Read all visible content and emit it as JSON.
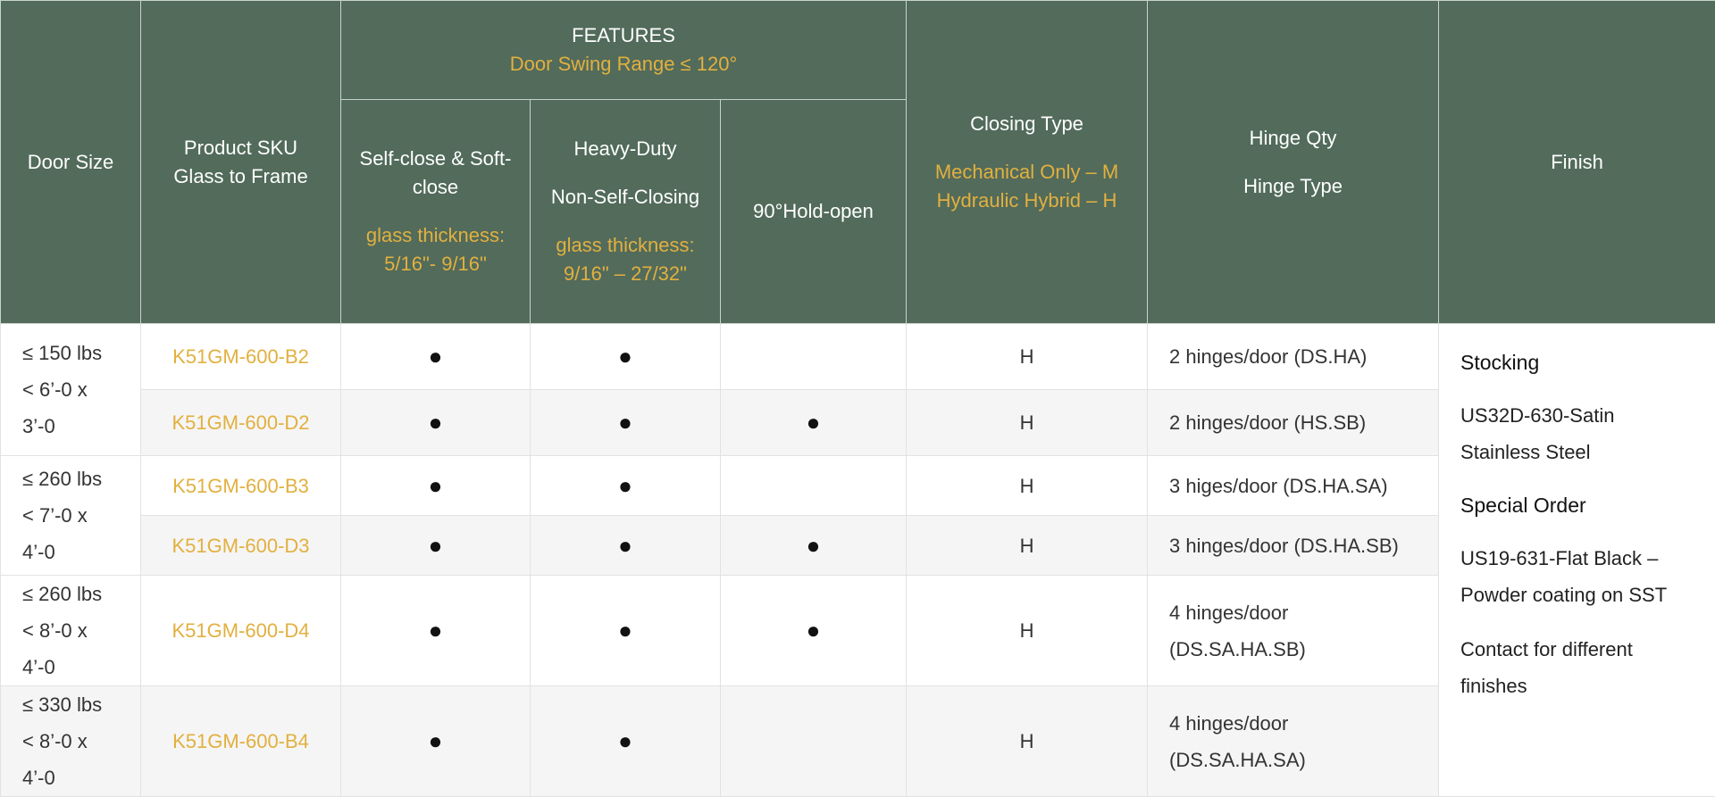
{
  "header": {
    "door_size": "Door Size",
    "sku_line1": "Product SKU",
    "sku_line2": "Glass to Frame",
    "features": "FEATURES",
    "features_sub": "Door Swing Range ≤ 120°",
    "selfclose_line1": "Self-close & Soft-close",
    "selfclose_glass_line1": "glass thickness:",
    "selfclose_glass_line2": "5/16\"- 9/16\"",
    "heavy_line1": "Heavy-Duty",
    "heavy_line2": "Non-Self-Closing",
    "heavy_glass_line1": "glass thickness:",
    "heavy_glass_line2": "9/16\" – 27/32\"",
    "hold_open": "90°Hold-open",
    "closing_type": "Closing Type",
    "closing_m": "Mechanical Only – M",
    "closing_h": "Hydraulic Hybrid – H",
    "hinge_qty": "Hinge Qty",
    "hinge_type": "Hinge Type",
    "finish": "Finish"
  },
  "groups": [
    {
      "weight": "≤ 150 lbs",
      "size": "< 6’-0 x 3’-0"
    },
    {
      "weight": "≤ 260 lbs",
      "size": "< 7’-0 x 4’-0"
    },
    {
      "weight": "≤ 260 lbs",
      "size": "< 8’-0 x 4’-0"
    },
    {
      "weight": "≤ 330 lbs",
      "size": "< 8’-0 x 4’-0"
    }
  ],
  "rows": [
    {
      "sku": "K51GM-600-B2",
      "selfclose": "●",
      "heavy": "●",
      "hold": "",
      "closing": "H",
      "hinge": "2 hinges/door (DS.HA)"
    },
    {
      "sku": "K51GM-600-D2",
      "selfclose": "●",
      "heavy": "●",
      "hold": "●",
      "closing": "H",
      "hinge": "2 hinges/door (HS.SB)"
    },
    {
      "sku": "K51GM-600-B3",
      "selfclose": "●",
      "heavy": "●",
      "hold": "",
      "closing": "H",
      "hinge": "3 higes/door (DS.HA.SA)"
    },
    {
      "sku": "K51GM-600-D3",
      "selfclose": "●",
      "heavy": "●",
      "hold": "●",
      "closing": "H",
      "hinge": "3 hinges/door (DS.HA.SB)"
    },
    {
      "sku": "K51GM-600-D4",
      "selfclose": "●",
      "heavy": "●",
      "hold": "●",
      "closing": "H",
      "hinge_line1": "4 hinges/door",
      "hinge_line2": "(DS.SA.HA.SB)"
    },
    {
      "sku": "K51GM-600-B4",
      "selfclose": "●",
      "heavy": "●",
      "hold": "",
      "closing": "H",
      "hinge_line1": "4 hinges/door",
      "hinge_line2": "(DS.SA.HA.SA)"
    }
  ],
  "finish": {
    "stocking_head": "Stocking",
    "stocking_text": "US32D-630-Satin Stainless Steel",
    "special_head": "Special Order",
    "special_text": "US19-631-Flat Black – Powder coating on SST",
    "contact_text": "Contact for different finishes"
  }
}
